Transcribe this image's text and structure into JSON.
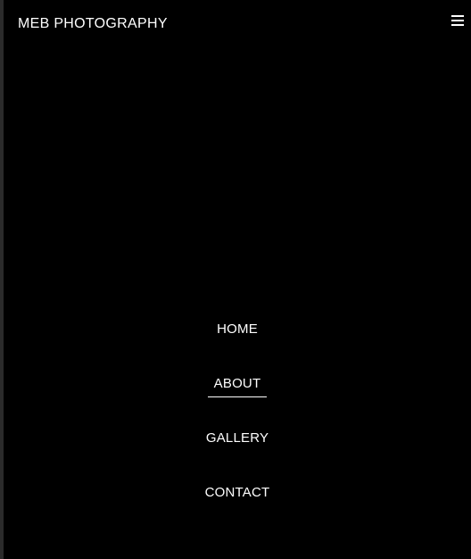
{
  "header": {
    "brand": "MEB PHOTOGRAPHY",
    "menu_icon": "hamburger-icon"
  },
  "nav": {
    "items": [
      {
        "label": "HOME",
        "active": false
      },
      {
        "label": "ABOUT",
        "active": true
      },
      {
        "label": "GALLERY",
        "active": false
      },
      {
        "label": "CONTACT",
        "active": false
      }
    ]
  },
  "colors": {
    "background": "#000000",
    "text": "#ffffff",
    "active_underline": "#ffffff"
  }
}
